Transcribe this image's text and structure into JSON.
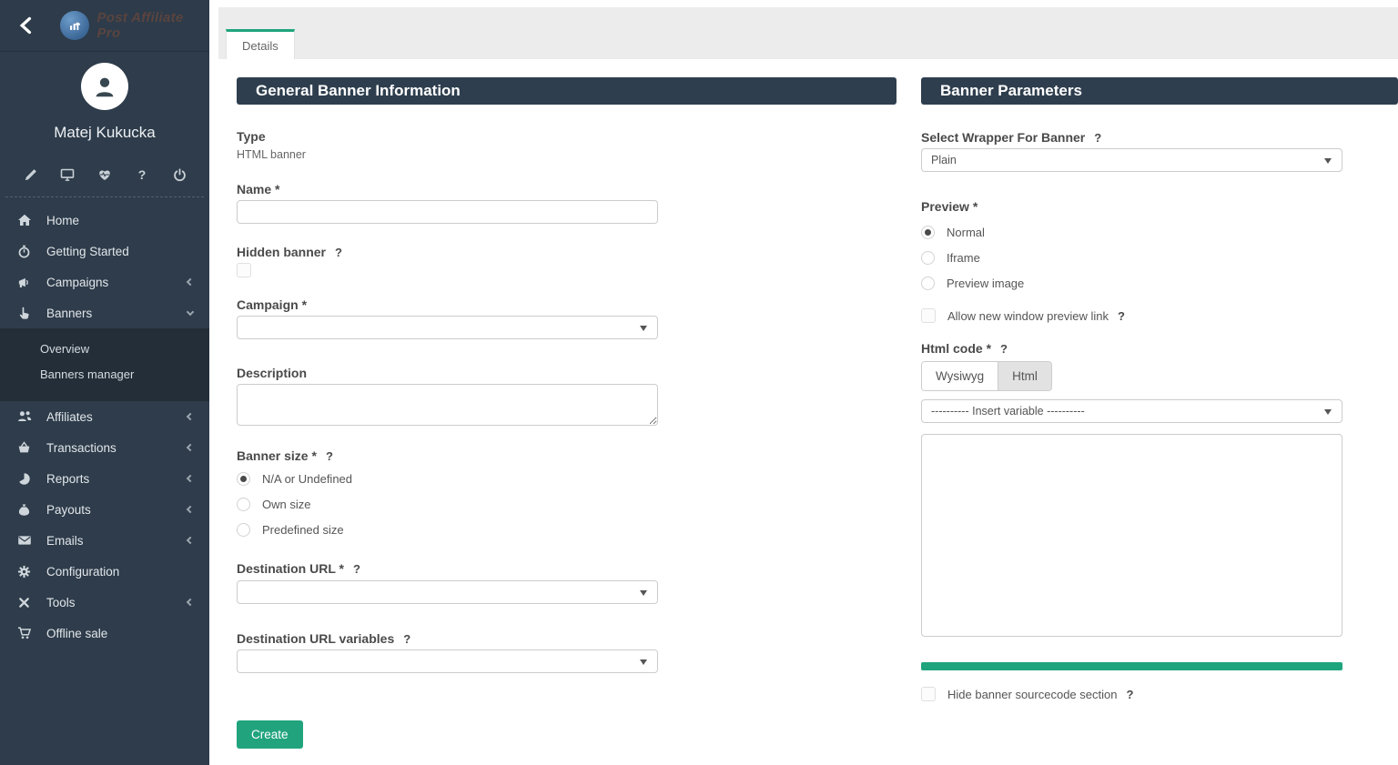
{
  "colors": {
    "accent": "#1fa57d",
    "sidebar_bg": "#2e3c4b",
    "panel_header_bg": "#2e3e4e",
    "submenu_bg": "#232e39"
  },
  "ui": {
    "help_glyph": "?"
  },
  "brand": {
    "name": "Post Affiliate Pro"
  },
  "profile": {
    "name": "Matej Kukucka",
    "action_icons": [
      "edit-pencil",
      "monitor",
      "heart-pulse",
      "help",
      "power"
    ]
  },
  "sidebar": {
    "items": [
      {
        "label": "Home"
      },
      {
        "label": "Getting Started"
      },
      {
        "label": "Campaigns"
      },
      {
        "label": "Banners"
      },
      {
        "label": "Affiliates"
      },
      {
        "label": "Transactions"
      },
      {
        "label": "Reports"
      },
      {
        "label": "Payouts"
      },
      {
        "label": "Emails"
      },
      {
        "label": "Configuration"
      },
      {
        "label": "Tools"
      },
      {
        "label": "Offline sale"
      }
    ],
    "banners_submenu": [
      {
        "label": "Overview"
      },
      {
        "label": "Banners manager"
      }
    ],
    "expanded_item": "Banners"
  },
  "tabs": {
    "details": "Details"
  },
  "general": {
    "title": "General Banner Information",
    "type_label": "Type",
    "type_value": "HTML banner",
    "name_label": "Name *",
    "name_value": "",
    "hidden_banner_label": "Hidden banner",
    "hidden_banner_checked": false,
    "campaign_label": "Campaign *",
    "campaign_value": "",
    "description_label": "Description",
    "description_value": "",
    "banner_size_label": "Banner size *",
    "banner_size_options": [
      "N/A or Undefined",
      "Own size",
      "Predefined size"
    ],
    "banner_size_selected": "N/A or Undefined",
    "destination_url_label": "Destination URL *",
    "destination_url_value": "",
    "destination_url_variables_label": "Destination URL variables",
    "destination_url_variables_value": "",
    "create_button": "Create"
  },
  "params": {
    "title": "Banner Parameters",
    "wrapper_label": "Select Wrapper For Banner",
    "wrapper_value": "Plain",
    "preview_label": "Preview *",
    "preview_options": [
      "Normal",
      "Iframe",
      "Preview image"
    ],
    "preview_selected": "Normal",
    "allow_new_window_label": "Allow new window preview link",
    "allow_new_window_checked": false,
    "html_code_label": "Html code *",
    "editor_tabs": [
      "Wysiwyg",
      "Html"
    ],
    "editor_active_tab": "Html",
    "insert_variable_placeholder": "---------- Insert variable ----------",
    "html_code_value": "",
    "hide_sourcecode_label": "Hide banner sourcecode section",
    "hide_sourcecode_checked": false
  }
}
